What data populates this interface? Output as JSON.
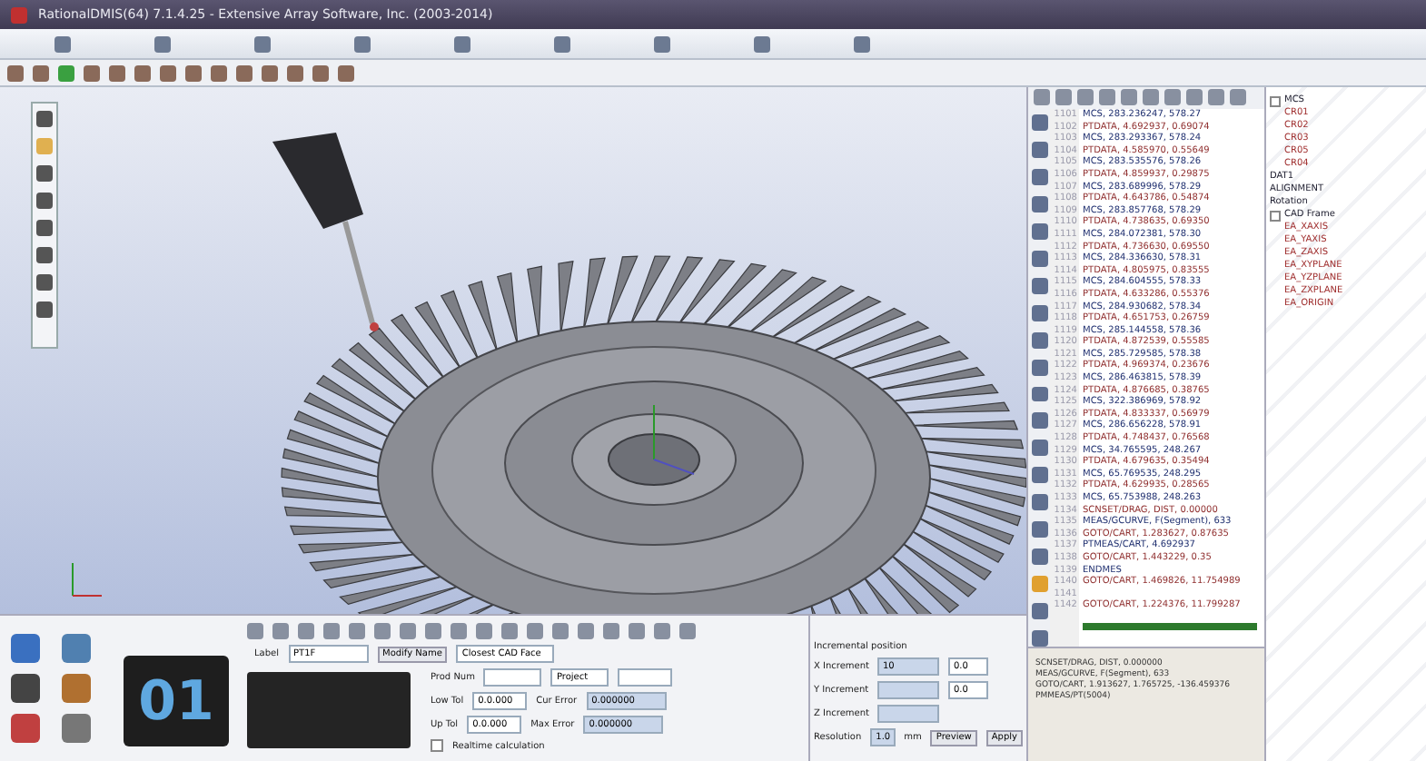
{
  "window": {
    "title": "RationalDMIS(64) 7.1.4.25 - Extensive Array Software, Inc. (2003-2014)"
  },
  "code": {
    "lines": [
      {
        "number": "1101",
        "text": "MCS, 283.236247, 578.27"
      },
      {
        "number": "1102",
        "text": "PTDATA, 4.692937, 0.69074"
      },
      {
        "number": "1103",
        "text": "MCS, 283.293367, 578.24"
      },
      {
        "number": "1104",
        "text": "PTDATA, 4.585970, 0.55649"
      },
      {
        "number": "1105",
        "text": "MCS, 283.535576, 578.26"
      },
      {
        "number": "1106",
        "text": "PTDATA, 4.859937, 0.29875"
      },
      {
        "number": "1107",
        "text": "MCS, 283.689996, 578.29"
      },
      {
        "number": "1108",
        "text": "PTDATA, 4.643786, 0.54874"
      },
      {
        "number": "1109",
        "text": "MCS, 283.857768, 578.29"
      },
      {
        "number": "1110",
        "text": "PTDATA, 4.738635, 0.69350"
      },
      {
        "number": "1111",
        "text": "MCS, 284.072381, 578.30"
      },
      {
        "number": "1112",
        "text": "PTDATA, 4.736630, 0.69550"
      },
      {
        "number": "1113",
        "text": "MCS, 284.336630, 578.31"
      },
      {
        "number": "1114",
        "text": "PTDATA, 4.805975, 0.83555"
      },
      {
        "number": "1115",
        "text": "MCS, 284.604555, 578.33"
      },
      {
        "number": "1116",
        "text": "PTDATA, 4.633286, 0.55376"
      },
      {
        "number": "1117",
        "text": "MCS, 284.930682, 578.34"
      },
      {
        "number": "1118",
        "text": "PTDATA, 4.651753, 0.26759"
      },
      {
        "number": "1119",
        "text": "MCS, 285.144558, 578.36"
      },
      {
        "number": "1120",
        "text": "PTDATA, 4.872539, 0.55585"
      },
      {
        "number": "1121",
        "text": "MCS, 285.729585, 578.38"
      },
      {
        "number": "1122",
        "text": "PTDATA, 4.969374, 0.23676"
      },
      {
        "number": "1123",
        "text": "MCS, 286.463815, 578.39"
      },
      {
        "number": "1124",
        "text": "PTDATA, 4.876685, 0.38765"
      },
      {
        "number": "1125",
        "text": "MCS, 322.386969, 578.92"
      },
      {
        "number": "1126",
        "text": "PTDATA, 4.833337, 0.56979"
      },
      {
        "number": "1127",
        "text": "MCS, 286.656228, 578.91"
      },
      {
        "number": "1128",
        "text": "PTDATA, 4.748437, 0.76568"
      },
      {
        "number": "1129",
        "text": "MCS, 34.765595, 248.267"
      },
      {
        "number": "1130",
        "text": "PTDATA, 4.679635, 0.35494"
      },
      {
        "number": "1131",
        "text": "MCS, 65.769535, 248.295"
      },
      {
        "number": "1132",
        "text": "PTDATA, 4.629935, 0.28565"
      },
      {
        "number": "1133",
        "text": "MCS, 65.753988, 248.263"
      },
      {
        "number": "1134",
        "text": "SCNSET/DRAG, DIST, 0.00000"
      },
      {
        "number": "1135",
        "text": "MEAS/GCURVE, F(Segment), 633"
      },
      {
        "number": "1136",
        "text": "  GOTO/CART, 1.283627, 0.87635"
      },
      {
        "number": "1137",
        "text": "  PTMEAS/CART, 4.692937"
      },
      {
        "number": "1138",
        "text": "  GOTO/CART, 1.443229, 0.35"
      },
      {
        "number": "1139",
        "text": "ENDMES"
      },
      {
        "number": "1140",
        "text": "GOTO/CART, 1.469826, 11.754989"
      },
      {
        "number": "1141"
      },
      {
        "number": "1142",
        "text": "GOTO/CART, 1.224376, 11.799287"
      }
    ],
    "output": [
      "SCNSET/DRAG, DIST, 0.000000",
      "MEAS/GCURVE, F(Segment), 633",
      "GOTO/CART, 1.913627, 1.765725, -136.459376",
      "PMMEAS/PT(5004)"
    ]
  },
  "tree": {
    "items": [
      {
        "label": "MCS",
        "expanded": true,
        "children": [
          {
            "label": "CR01"
          },
          {
            "label": "CR02"
          },
          {
            "label": "CR03"
          },
          {
            "label": "CR05"
          },
          {
            "label": "CR04"
          }
        ]
      },
      {
        "label": "DAT1"
      },
      {
        "label": "ALIGNMENT"
      },
      {
        "label": "Rotation"
      },
      {
        "label": "CAD Frame",
        "expanded": true,
        "children": [
          {
            "label": "EA_XAXIS"
          },
          {
            "label": "EA_YAXIS"
          },
          {
            "label": "EA_ZAXIS"
          },
          {
            "label": "EA_XYPLANE"
          },
          {
            "label": "EA_YZPLANE"
          },
          {
            "label": "EA_ZXPLANE"
          },
          {
            "label": "EA_ORIGIN"
          }
        ]
      }
    ]
  },
  "feature": {
    "counter": "01",
    "label_caption": "Label",
    "label_value": "PT1F",
    "button": "Modify Name",
    "dropdown": "Closest CAD Face",
    "prod_num": "Prod Num",
    "project": "Project",
    "low_tol": "Low Tol",
    "low_tol_value": "0.0.000",
    "up_tol": "Up Tol",
    "up_tol_value": "0.0.000",
    "cur_error": "Cur Error",
    "max_error": "Max Error",
    "cur_error_value": "0.000000",
    "max_error_value": "0.000000",
    "realtime": {
      "label": "Realtime calculation",
      "checked": false
    }
  },
  "increment": {
    "title": "Incremental position",
    "fields": [
      {
        "label": "X Increment",
        "value": "10",
        "unit_value": "0.0"
      },
      {
        "label": "Y Increment",
        "unit_value": "0.0"
      },
      {
        "label": "Z Increment"
      }
    ],
    "resolution_label": "Resolution",
    "resolution_value": "1.0",
    "unit": "mm",
    "buttons": [
      "Preview",
      "Apply"
    ]
  }
}
